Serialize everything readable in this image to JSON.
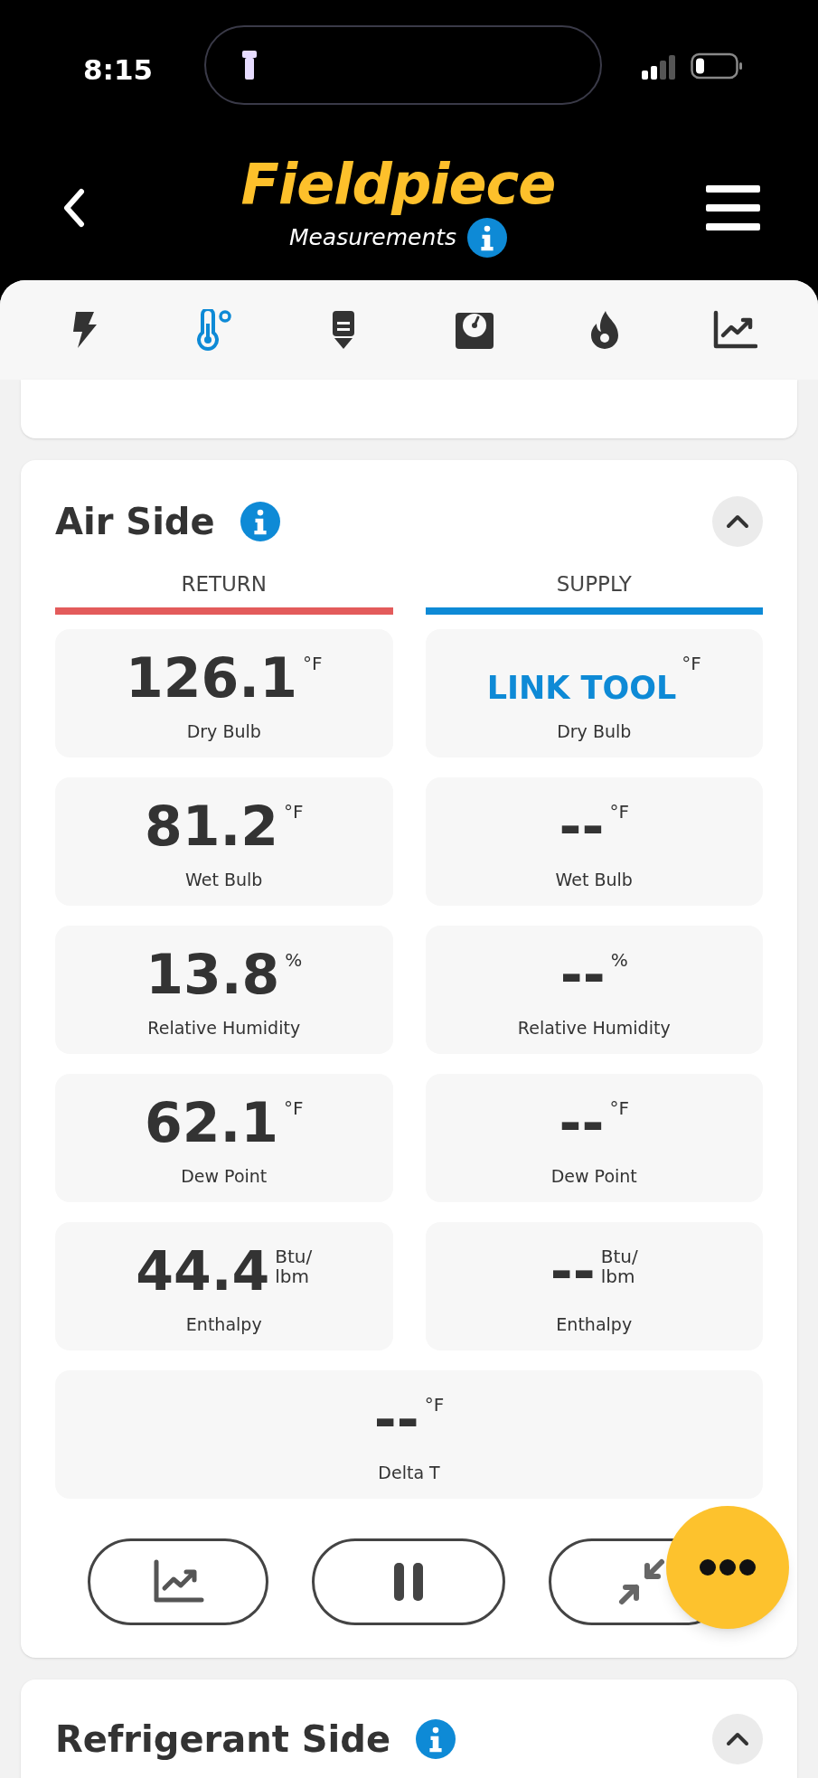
{
  "status_bar": {
    "time": "8:15"
  },
  "header": {
    "title": "Fieldpiece",
    "subtitle": "Measurements"
  },
  "nav_tabs": [
    {
      "selected": false
    },
    {
      "selected": true
    },
    {
      "selected": false
    },
    {
      "selected": false
    },
    {
      "selected": false
    },
    {
      "selected": false
    }
  ],
  "air_side": {
    "title": "Air Side",
    "expanded": true,
    "columns": [
      {
        "label": "RETURN",
        "color": "#e35b5b"
      },
      {
        "label": "SUPPLY",
        "color": "#0e8ad6"
      }
    ],
    "rows": [
      {
        "cells": [
          {
            "kind": "reading",
            "value": "126.1",
            "unit_lines": [
              "°F"
            ],
            "label": "Dry Bulb"
          },
          {
            "kind": "link",
            "value": "LINK TOOL",
            "unit_lines": [
              "°F"
            ],
            "label": "Dry Bulb"
          }
        ]
      },
      {
        "cells": [
          {
            "kind": "reading",
            "value": "81.2",
            "unit_lines": [
              "°F"
            ],
            "label": "Wet Bulb"
          },
          {
            "kind": "reading",
            "value": "--",
            "unit_lines": [
              "°F"
            ],
            "label": "Wet Bulb"
          }
        ]
      },
      {
        "cells": [
          {
            "kind": "reading",
            "value": "13.8",
            "unit_lines": [
              "%"
            ],
            "label": "Relative Humidity"
          },
          {
            "kind": "reading",
            "value": "--",
            "unit_lines": [
              "%"
            ],
            "label": "Relative Humidity"
          }
        ]
      },
      {
        "cells": [
          {
            "kind": "reading",
            "value": "62.1",
            "unit_lines": [
              "°F"
            ],
            "label": "Dew Point"
          },
          {
            "kind": "reading",
            "value": "--",
            "unit_lines": [
              "°F"
            ],
            "label": "Dew Point"
          }
        ]
      },
      {
        "cells": [
          {
            "kind": "reading",
            "value": "44.4",
            "unit_lines": [
              "Btu/",
              "lbm"
            ],
            "label": "Enthalpy"
          },
          {
            "kind": "reading",
            "value": "--",
            "unit_lines": [
              "Btu/",
              "lbm"
            ],
            "label": "Enthalpy"
          }
        ]
      },
      {
        "cells": [
          {
            "kind": "reading",
            "value": "--",
            "unit_lines": [
              "°F"
            ],
            "label": "Delta T"
          }
        ]
      }
    ],
    "paused": false
  },
  "refrigerant_side": {
    "title": "Refrigerant Side",
    "expanded": true
  }
}
